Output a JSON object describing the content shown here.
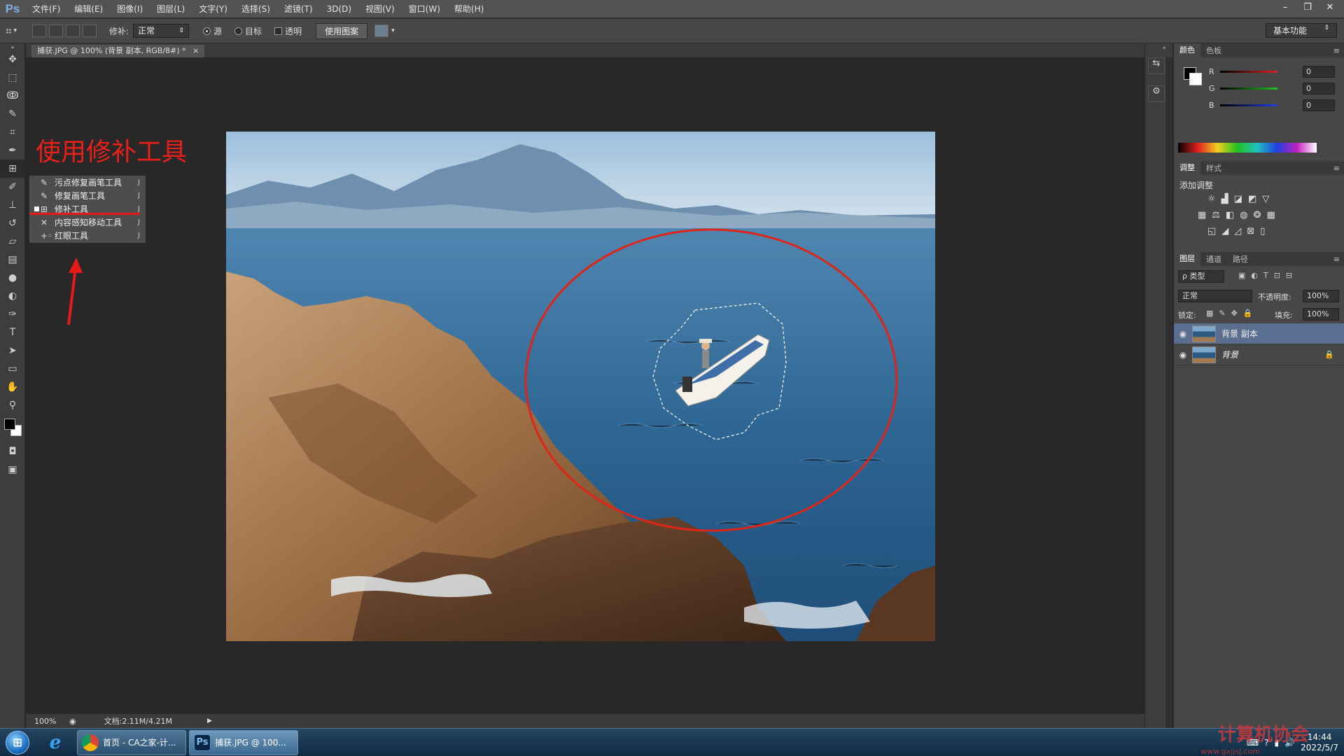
{
  "app": {
    "logo": "Ps",
    "window_controls": [
      "–",
      "❐",
      "✕"
    ]
  },
  "menu": [
    "文件(F)",
    "编辑(E)",
    "图像(I)",
    "图层(L)",
    "文字(Y)",
    "选择(S)",
    "滤镜(T)",
    "3D(D)",
    "视图(V)",
    "窗口(W)",
    "帮助(H)"
  ],
  "options": {
    "patch_label": "修补:",
    "mode_value": "正常",
    "source_label": "源",
    "source_checked": true,
    "target_label": "目标",
    "target_checked": false,
    "transparent_label": "透明",
    "transparent_checked": false,
    "use_pattern_label": "使用图案",
    "workspace": "基本功能"
  },
  "document": {
    "tab_title": "捕获.JPG @ 100% (背景 副本, RGB/8#) *",
    "close": "×"
  },
  "annotation": {
    "title": "使用修补工具",
    "title_color": "#e8201a"
  },
  "flyout": {
    "items": [
      {
        "icon": "spot-healing-brush-icon",
        "label": "污点修复画笔工具",
        "key": "J",
        "active": false
      },
      {
        "icon": "healing-brush-icon",
        "label": "修复画笔工具",
        "key": "J",
        "active": false
      },
      {
        "icon": "patch-tool-icon",
        "label": "修补工具",
        "key": "J",
        "active": true
      },
      {
        "icon": "content-aware-move-icon",
        "label": "内容感知移动工具",
        "key": "J",
        "active": false
      },
      {
        "icon": "red-eye-icon",
        "label": "红眼工具",
        "key": "J",
        "active": false
      }
    ]
  },
  "status": {
    "zoom": "100%",
    "doc_info": "文档:2.11M/4.21M"
  },
  "color_panel": {
    "tabs": [
      "颜色",
      "色板"
    ],
    "channels": [
      {
        "label": "R",
        "value": "0",
        "color": "#e02020"
      },
      {
        "label": "G",
        "value": "0",
        "color": "#20c020"
      },
      {
        "label": "B",
        "value": "0",
        "color": "#2040e0"
      }
    ]
  },
  "adjust_panel": {
    "tabs": [
      "调整",
      "样式"
    ],
    "heading": "添加调整"
  },
  "layers_panel": {
    "tabs": [
      "图层",
      "通道",
      "路径"
    ],
    "filter_label": "ρ 类型",
    "blend_mode": "正常",
    "opacity_label": "不透明度:",
    "opacity_value": "100%",
    "lock_label": "锁定:",
    "fill_label": "填充:",
    "fill_value": "100%",
    "layers": [
      {
        "name": "背景 副本",
        "selected": true,
        "locked": false
      },
      {
        "name": "背景",
        "selected": false,
        "locked": true
      }
    ]
  },
  "taskbar": {
    "buttons": [
      {
        "label": "首页 - CA之家-计...",
        "active": false
      },
      {
        "label": "捕获.JPG @ 100...",
        "active": true
      }
    ],
    "time": "14:44",
    "date": "2022/5/7",
    "watermark": "计算机协会",
    "watermark_url": "www.gxjjsj.com"
  }
}
